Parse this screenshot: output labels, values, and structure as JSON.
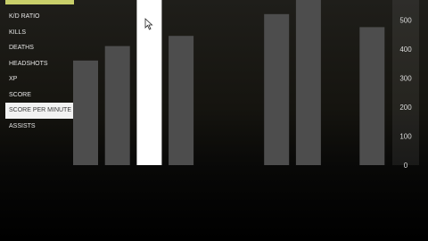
{
  "stats_menu": {
    "items": [
      {
        "label": "K/D RATIO"
      },
      {
        "label": "KILLS"
      },
      {
        "label": "DEATHS"
      },
      {
        "label": "HEADSHOTS"
      },
      {
        "label": "XP"
      },
      {
        "label": "SCORE"
      },
      {
        "label": "SCORE PER MINUTE",
        "selected": true
      },
      {
        "label": "ASSISTS"
      }
    ]
  },
  "chart_data": {
    "type": "bar",
    "ylim": [
      0,
      550
    ],
    "yticks": [
      0,
      100,
      200,
      300,
      400,
      500
    ],
    "bars": [
      {
        "value": 360,
        "highlighted": false
      },
      {
        "value": 410,
        "highlighted": false
      },
      {
        "value": 620,
        "highlighted": true
      },
      {
        "value": 445,
        "highlighted": false
      },
      {
        "value": 0,
        "highlighted": false
      },
      {
        "value": 0,
        "highlighted": false
      },
      {
        "value": 520,
        "highlighted": false
      },
      {
        "value": 620,
        "highlighted": false
      },
      {
        "value": 0,
        "highlighted": false
      },
      {
        "value": 475,
        "highlighted": false
      }
    ]
  },
  "colors": {
    "bar": "#4d4d4d",
    "bar_highlight": "#ffffff",
    "accent": "#c9cf6a",
    "axis_text": "#dcdcdc"
  }
}
